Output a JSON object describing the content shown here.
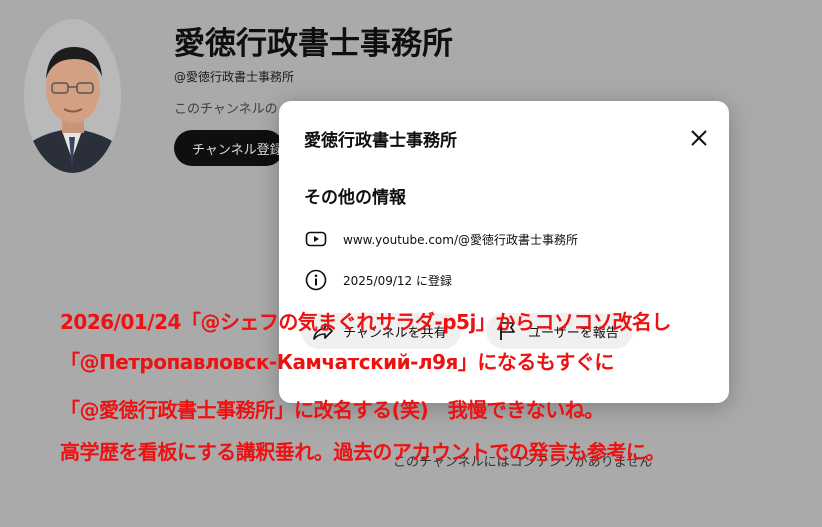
{
  "channel": {
    "name": "愛徳行政書士事務所",
    "handle": "@愛徳行政書士事務所",
    "description_visible": "このチャンネルの",
    "subscribe_label": "チャンネル登録",
    "empty_message": "このチャンネルにはコンテンツがありません"
  },
  "dialog": {
    "title": "愛徳行政書士事務所",
    "section_heading": "その他の情報",
    "url_text": "www.youtube.com/@愛徳行政書士事務所",
    "joined_text": "2025/09/12 に登録",
    "share_label": "チャンネルを共有",
    "report_label": "ユーザーを報告",
    "icons": [
      "youtube-icon",
      "info-icon",
      "share-icon",
      "flag-icon",
      "close-icon"
    ]
  },
  "overlay_annotation": {
    "color": "#ee1111",
    "line1": "2026/01/24「@シェフの気まぐれサラダ-p5j」からコソコソ改名し",
    "line2": "「@Петропавловск-Камчатский-л9я」になるもすぐに",
    "line3": "「@愛徳行政書士事務所」に改名する(笑)　我慢できないね。",
    "line4": "高学歴を看板にする講釈垂れ。過去のアカウントでの発言も参考に。"
  }
}
